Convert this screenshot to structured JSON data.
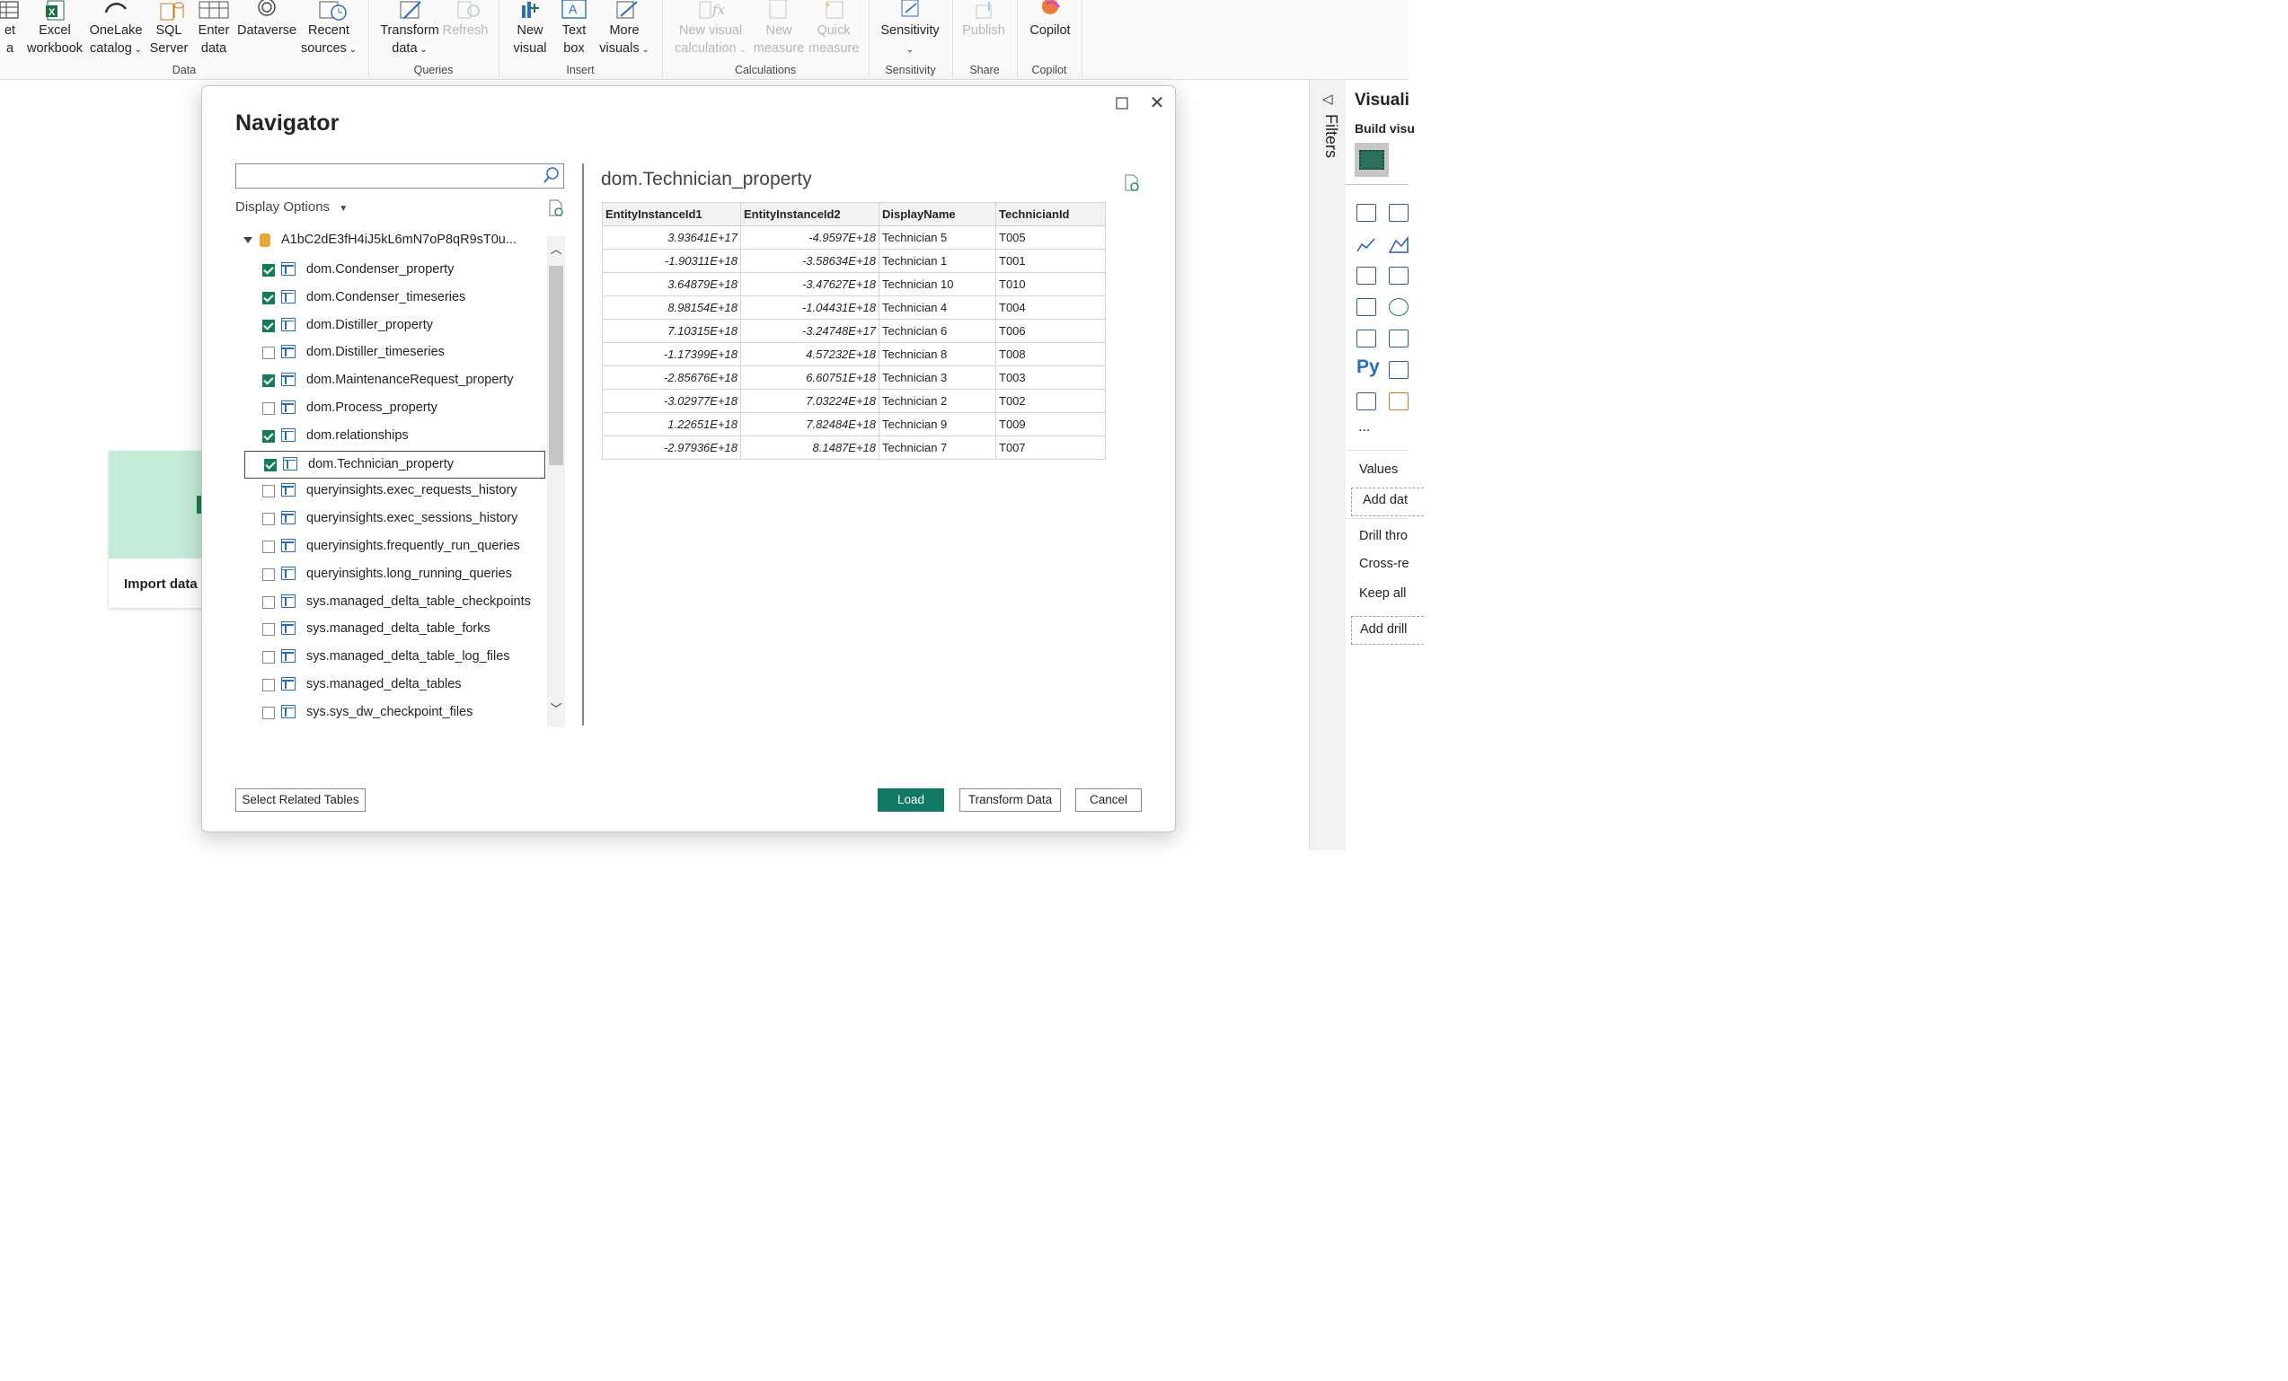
{
  "ribbon": {
    "buttons": [
      {
        "label": "et\na",
        "group": "data"
      },
      {
        "label": "Excel\nworkbook"
      },
      {
        "label": "OneLake\ncatalog"
      },
      {
        "label": "SQL\nServer"
      },
      {
        "label": "Enter\ndata"
      },
      {
        "label": "Dataverse"
      },
      {
        "label": "Recent\nsources"
      },
      {
        "label": "Transform\ndata"
      },
      {
        "label": "Refresh"
      },
      {
        "label": "New\nvisual"
      },
      {
        "label": "Text\nbox"
      },
      {
        "label": "More\nvisuals"
      },
      {
        "label": "New visual\ncalculation"
      },
      {
        "label": "New\nmeasure"
      },
      {
        "label": "Quick\nmeasure"
      },
      {
        "label": "Sensitivity"
      },
      {
        "label": "Publish"
      },
      {
        "label": "Copilot"
      }
    ],
    "groups": [
      "Data",
      "Queries",
      "Insert",
      "Calculations",
      "Sensitivity",
      "Share",
      "Copilot"
    ]
  },
  "canvas": {
    "import_card_label": "Import data"
  },
  "filters_pane": {
    "title": "Filters"
  },
  "viz_pane": {
    "title": "Visuali",
    "build_label": "Build visu",
    "values_label": "Values",
    "add_data": "Add dat",
    "drill_label": "Drill thro",
    "cross_report": "Cross-re",
    "keep_all": "Keep all",
    "add_drill": "Add drill",
    "more": "..."
  },
  "navigator": {
    "title": "Navigator",
    "search_placeholder": "",
    "display_options": "Display Options",
    "root_name": "A1bC2dE3fH4iJ5kL6mN7oP8qR9sT0u...",
    "items": [
      {
        "name": "dom.Condenser_property",
        "checked": true
      },
      {
        "name": "dom.Condenser_timeseries",
        "checked": true
      },
      {
        "name": "dom.Distiller_property",
        "checked": true
      },
      {
        "name": "dom.Distiller_timeseries",
        "checked": false
      },
      {
        "name": "dom.MaintenanceRequest_property",
        "checked": true
      },
      {
        "name": "dom.Process_property",
        "checked": false
      },
      {
        "name": "dom.relationships",
        "checked": true
      },
      {
        "name": "dom.Technician_property",
        "checked": true,
        "selected": true
      },
      {
        "name": "queryinsights.exec_requests_history",
        "checked": false
      },
      {
        "name": "queryinsights.exec_sessions_history",
        "checked": false
      },
      {
        "name": "queryinsights.frequently_run_queries",
        "checked": false
      },
      {
        "name": "queryinsights.long_running_queries",
        "checked": false
      },
      {
        "name": "sys.managed_delta_table_checkpoints",
        "checked": false
      },
      {
        "name": "sys.managed_delta_table_forks",
        "checked": false
      },
      {
        "name": "sys.managed_delta_table_log_files",
        "checked": false
      },
      {
        "name": "sys.managed_delta_tables",
        "checked": false
      },
      {
        "name": "sys.sys_dw_checkpoint_files",
        "checked": false
      }
    ],
    "preview": {
      "title": "dom.Technician_property",
      "columns": [
        "EntityInstanceId1",
        "EntityInstanceId2",
        "DisplayName",
        "TechnicianId"
      ],
      "rows": [
        [
          "3.93641E+17",
          "-4.9597E+18",
          "Technician 5",
          "T005"
        ],
        [
          "-1.90311E+18",
          "-3.58634E+18",
          "Technician 1",
          "T001"
        ],
        [
          "3.64879E+18",
          "-3.47627E+18",
          "Technician 10",
          "T010"
        ],
        [
          "8.98154E+18",
          "-1.04431E+18",
          "Technician 4",
          "T004"
        ],
        [
          "7.10315E+18",
          "-3.24748E+17",
          "Technician 6",
          "T006"
        ],
        [
          "-1.17399E+18",
          "4.57232E+18",
          "Technician 8",
          "T008"
        ],
        [
          "-2.85676E+18",
          "6.60751E+18",
          "Technician 3",
          "T003"
        ],
        [
          "-3.02977E+18",
          "7.03224E+18",
          "Technician 2",
          "T002"
        ],
        [
          "1.22651E+18",
          "7.82484E+18",
          "Technician 9",
          "T009"
        ],
        [
          "-2.97936E+18",
          "8.1487E+18",
          "Technician 7",
          "T007"
        ]
      ]
    },
    "buttons": {
      "select_related": "Select Related Tables",
      "load": "Load",
      "transform": "Transform Data",
      "cancel": "Cancel"
    }
  },
  "colors": {
    "accent": "#117865",
    "checkbox": "#127c5c",
    "table_icon": "#2a6ebb"
  }
}
